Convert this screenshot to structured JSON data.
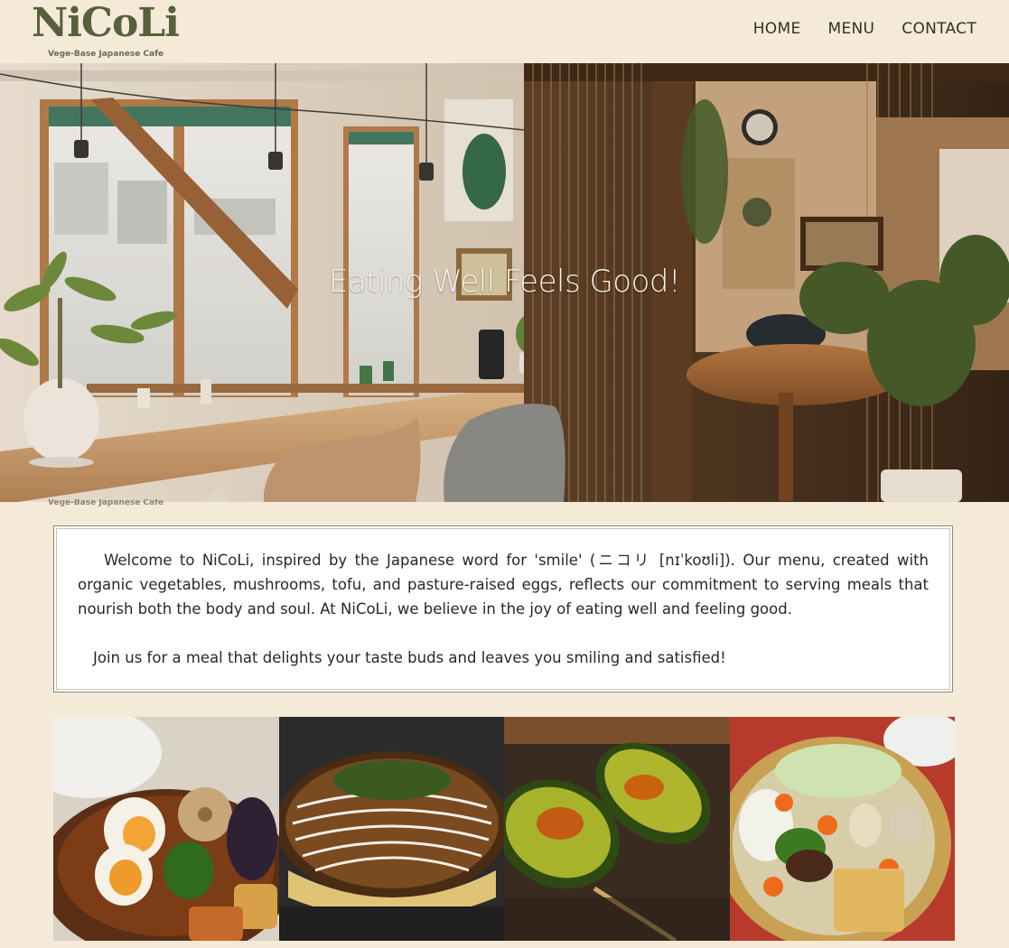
{
  "brand": {
    "name": "NiCoLi",
    "tagline": "Vege-Base Japanese Cafe"
  },
  "nav": {
    "items": [
      {
        "label": "HOME"
      },
      {
        "label": "MENU"
      },
      {
        "label": "CONTACT"
      }
    ]
  },
  "hero": {
    "title": "Eating Well Feels Good!",
    "image": "cafe-interior-photo"
  },
  "welcome": {
    "paragraph1": "Welcome to NiCoLi, inspired by the Japanese word for 'smile' (ニコリ [nɪˈkoʊli]). Our menu, created with organic vegetables, mushrooms, tofu, and pasture-raised eggs, reflects our commitment to serving meals that nourish both the body and soul. At NiCoLi, we believe in the joy of eating well and feeling good.",
    "paragraph2": "Join us for a meal that delights your taste buds and leaves you smiling and satisfied!"
  },
  "gallery": {
    "images": [
      {
        "subject": "vegetable-curry-with-eggs-photo"
      },
      {
        "subject": "okonomiyaki-photo"
      },
      {
        "subject": "grilled-avocado-photo"
      },
      {
        "subject": "vegetable-hotpot-photo"
      }
    ]
  },
  "colors": {
    "background": "#f5ead7",
    "logo": "#56613c",
    "nav_text": "#33302a",
    "hero_text": "#f6efe4",
    "box_background": "#ffffff"
  }
}
